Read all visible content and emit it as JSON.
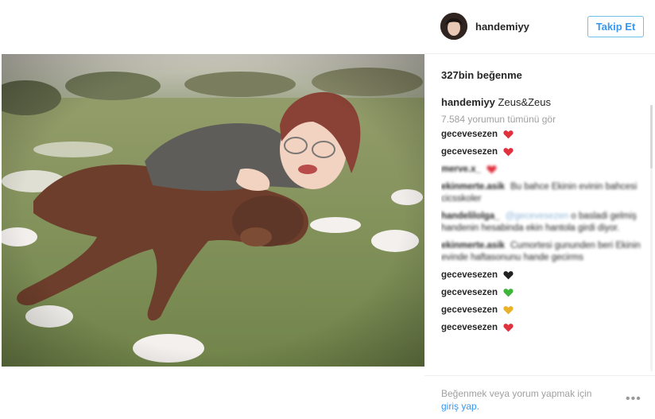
{
  "post": {
    "photo_alt": "",
    "username": "handemiyy",
    "follow_label": "Takip Et",
    "likes": "327bin beğenme",
    "caption_user": "handemiyy",
    "caption_text": "Zeus&Zeus",
    "view_all_comments": "7.584 yorumun tümünü gör"
  },
  "comments": [
    {
      "user": "gecevesezen",
      "text": "",
      "heart": "#e0323e",
      "blurred": false
    },
    {
      "user": "gecevesezen",
      "text": "",
      "heart": "#e0323e",
      "blurred": false
    },
    {
      "user": "merve.x_",
      "text": "",
      "heart": "#e0323e",
      "blurred": true
    },
    {
      "user": "ekinmerte.asik",
      "text": "Bu bahce Ekinin evinin bahcesi cicsskoler",
      "heart": "",
      "blurred": true
    },
    {
      "user": "handelilolga_",
      "mention": "@gecevesezen",
      "text": "o basladi gelmiş handenin hesabinda ekin hantola girdi diyor.",
      "heart": "",
      "blurred": true
    },
    {
      "user": "ekinmerte.asik",
      "text": "Cumortesi gununden beri Ekinin evinde haftasonunu hande gecirms",
      "heart": "",
      "blurred": true
    },
    {
      "user": "gecevesezen",
      "text": "",
      "heart": "#222222",
      "blurred": false
    },
    {
      "user": "gecevesezen",
      "text": "",
      "heart": "#3fb53b",
      "blurred": false
    },
    {
      "user": "gecevesezen",
      "text": "",
      "heart": "#e8b32a",
      "blurred": false
    },
    {
      "user": "gecevesezen",
      "text": "",
      "heart": "#e0323e",
      "blurred": false
    }
  ],
  "footer": {
    "login_prompt": "Beğenmek veya yorum yapmak için",
    "login_link": "giriş yap.",
    "more": "•••"
  }
}
